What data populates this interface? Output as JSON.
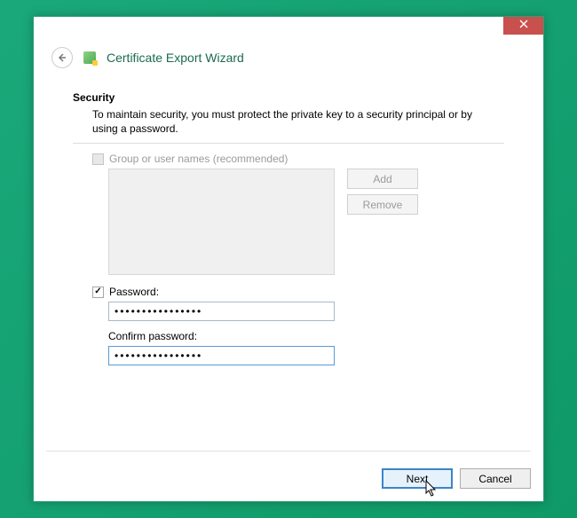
{
  "window": {
    "title": "Certificate Export Wizard"
  },
  "section": {
    "heading": "Security",
    "description": "To maintain security, you must protect the private key to a security principal or by using a password."
  },
  "groupOption": {
    "label": "Group or user names (recommended)",
    "checked": false,
    "enabled": false
  },
  "buttons": {
    "add": "Add",
    "remove": "Remove",
    "next": "Next",
    "cancel": "Cancel"
  },
  "passwordOption": {
    "label": "Password:",
    "checked": true,
    "value": "••••••••••••••••",
    "confirmLabel": "Confirm password:",
    "confirmValue": "••••••••••••••••"
  }
}
